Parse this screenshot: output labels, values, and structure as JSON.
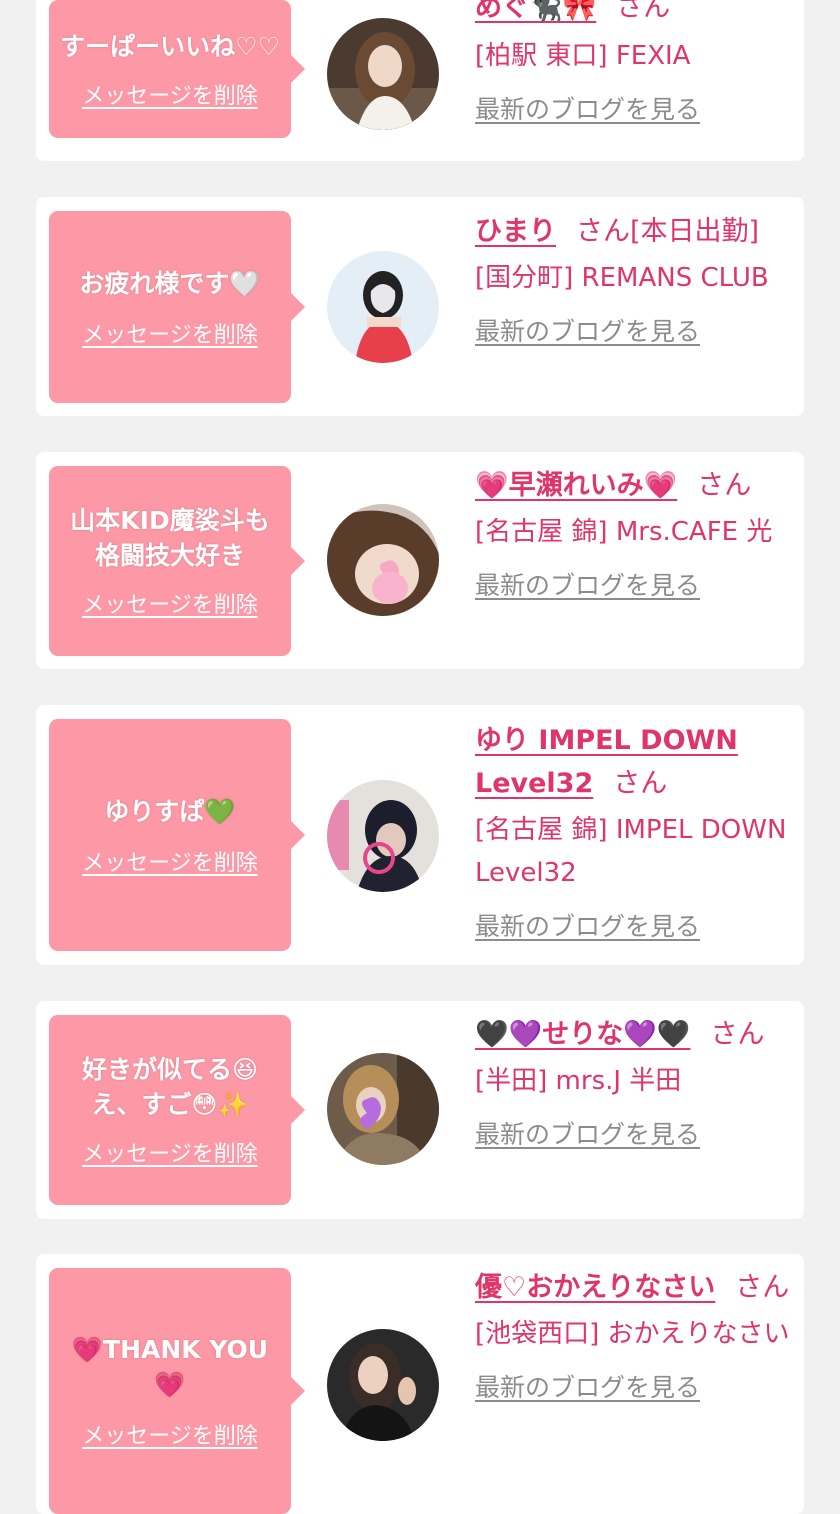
{
  "common": {
    "delete_label": "メッセージを削除",
    "blog_label": "最新のブログを見る",
    "san": "さん"
  },
  "items": [
    {
      "message": "すーぱーいいね♡♡",
      "name": "めぐ🐈‍⬛🎀",
      "name_suffix": "",
      "shop": "[柏駅 東口] FEXIA",
      "avatar_colors": [
        "#3a2b25",
        "#d9c2b0"
      ]
    },
    {
      "message": "お疲れ様です🤍",
      "name": "ひまり",
      "name_suffix": "[本日出勤]",
      "shop": "[国分町] REMANS CLUB",
      "avatar_colors": [
        "#dfeaf3",
        "#e8404a"
      ]
    },
    {
      "message": "山本KID魔裟斗も格闘技大好き",
      "name": "💗早瀬れいみ💗",
      "name_suffix": "",
      "shop": "[名古屋 錦] Mrs.CAFE 光",
      "avatar_colors": [
        "#6a4a36",
        "#f7b3cc"
      ]
    },
    {
      "message": "ゆりすぱ💚",
      "name": "ゆり IMPEL DOWN Level32",
      "name_suffix": "",
      "shop": "[名古屋 錦] IMPEL DOWN Level32",
      "avatar_colors": [
        "#1b1d2c",
        "#e8468a"
      ]
    },
    {
      "message": "好きが似てる😆 え、すご😳✨",
      "name": "🖤💜せりな💜🖤",
      "name_suffix": "",
      "shop": "[半田] mrs.J 半田",
      "avatar_colors": [
        "#7a6a58",
        "#b66ce0"
      ]
    },
    {
      "message": "💗THANK YOU💗",
      "name": "優♡おかえりなさい",
      "name_suffix": "",
      "shop": "[池袋西口] おかえりなさい",
      "avatar_colors": [
        "#1e1e1e",
        "#c9a48f"
      ]
    }
  ]
}
